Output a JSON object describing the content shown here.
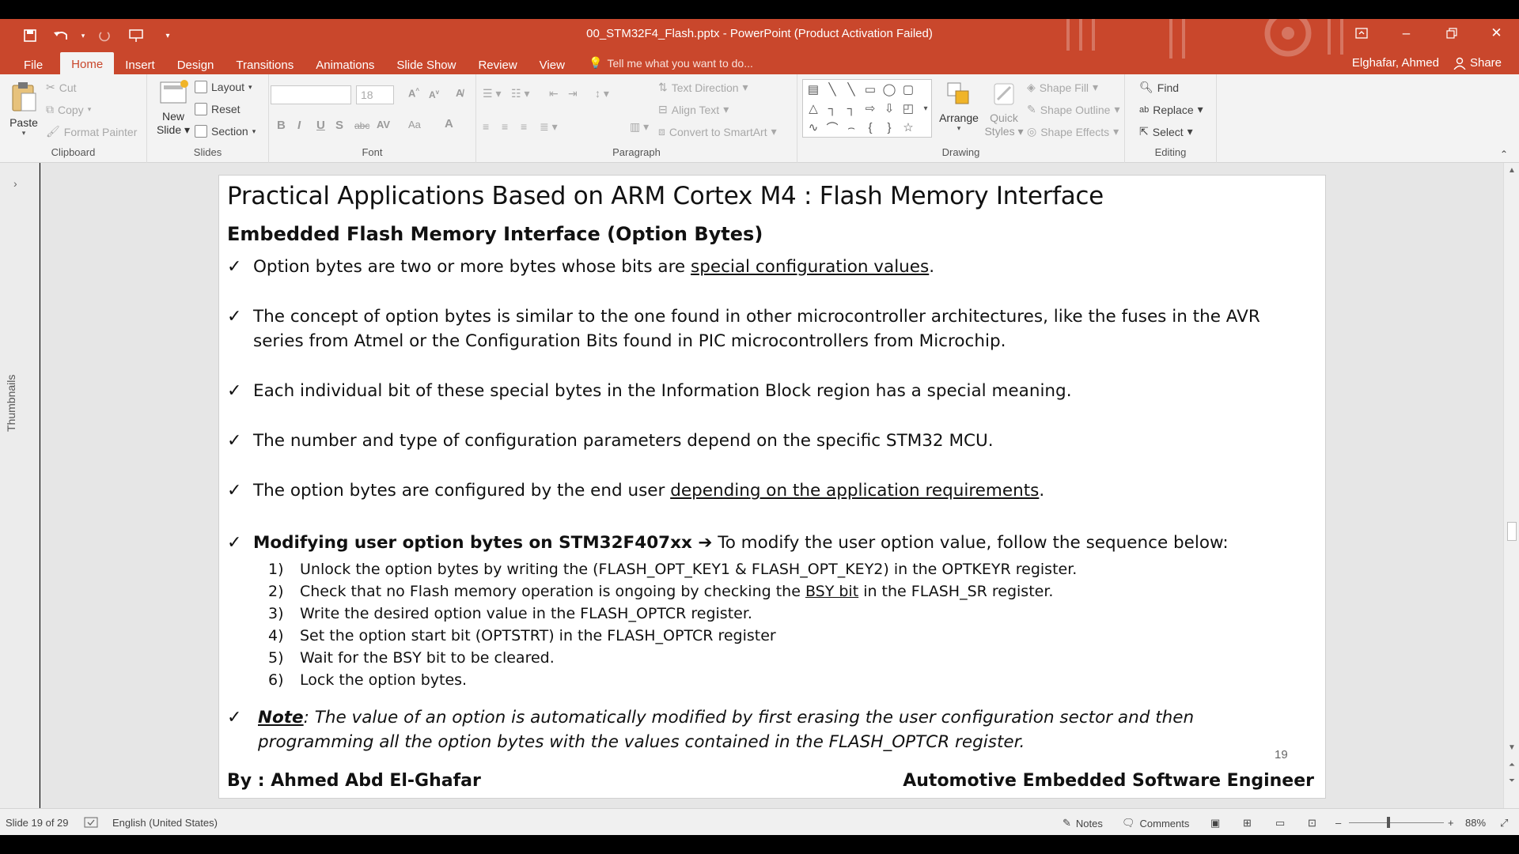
{
  "window": {
    "title": "00_STM32F4_Flash.pptx - PowerPoint (Product Activation Failed)",
    "qat": [
      "save-icon",
      "undo-icon",
      "redo-icon",
      "present-icon",
      "customize-icon"
    ],
    "controls": [
      "ribbon-display-icon",
      "minimize-icon",
      "restore-icon",
      "close-icon"
    ]
  },
  "tabs": [
    "File",
    "Home",
    "Insert",
    "Design",
    "Transitions",
    "Animations",
    "Slide Show",
    "Review",
    "View"
  ],
  "active_tab": "Home",
  "tell_me": "Tell me what you want to do...",
  "user": {
    "name": "Elghafar, Ahmed",
    "share": "Share"
  },
  "ribbon": {
    "clipboard": {
      "label": "Clipboard",
      "paste": "Paste",
      "cut": "Cut",
      "copy": "Copy",
      "format_painter": "Format Painter"
    },
    "slides": {
      "label": "Slides",
      "new_slide": "New",
      "new_slide2": "Slide",
      "layout": "Layout",
      "reset": "Reset",
      "section": "Section"
    },
    "font": {
      "label": "Font",
      "size": "18",
      "bold": "B",
      "italic": "I",
      "underline": "U",
      "shadow": "S",
      "strike": "abc",
      "spacing": "AV",
      "case": "Aa",
      "color": "A"
    },
    "paragraph": {
      "label": "Paragraph",
      "text_direction": "Text Direction",
      "align_text": "Align Text",
      "convert_smartart": "Convert to SmartArt"
    },
    "drawing": {
      "label": "Drawing",
      "arrange": "Arrange",
      "quick_styles": "Quick",
      "quick_styles2": "Styles",
      "shape_fill": "Shape Fill",
      "shape_outline": "Shape Outline",
      "shape_effects": "Shape Effects"
    },
    "editing": {
      "label": "Editing",
      "find": "Find",
      "replace": "Replace",
      "select": "Select"
    }
  },
  "thumbnails_label": "Thumbnails",
  "slide": {
    "title": "Practical Applications Based on ARM Cortex M4 : Flash Memory Interface",
    "subtitle": "Embedded Flash Memory Interface (Option Bytes)",
    "b1_pre": "Option bytes are two or more bytes whose bits are ",
    "b1_u": "special configuration values",
    "b1_post": ".",
    "b2": "The concept of option bytes is similar to the one found in other microcontroller architectures, like the fuses in the AVR series from Atmel or the Configuration Bits found in PIC microcontrollers from Microchip.",
    "b3": "Each individual bit of these special bytes in the Information Block region has a special meaning.",
    "b4": "The number and type of configuration parameters depend on the specific STM32 MCU.",
    "b5_pre": "The option bytes are configured by the end user ",
    "b5_u": "depending on the application requirements",
    "b5_post": ".",
    "b6_bold": "Modifying user option bytes on STM32F407xx ",
    "b6_arrow": "➔",
    "b6_rest": " To modify the user option value, follow the sequence below:",
    "steps": [
      {
        "num": "1)",
        "pre": "Unlock the option bytes by writing the (FLASH_OPT_KEY1 & FLASH_OPT_KEY2) in the OPTKEYR register.",
        "u": "",
        "post": ""
      },
      {
        "num": "2)",
        "pre": "Check that no Flash memory operation is ongoing by checking the ",
        "u": "BSY bit",
        "post": " in the FLASH_SR register."
      },
      {
        "num": "3)",
        "pre": "Write the desired option value in the FLASH_OPTCR register.",
        "u": "",
        "post": ""
      },
      {
        "num": "4)",
        "pre": "Set the option start bit (OPTSTRT) in the FLASH_OPTCR register",
        "u": "",
        "post": ""
      },
      {
        "num": "5)",
        "pre": "Wait for the BSY bit to be cleared.",
        "u": "",
        "post": ""
      },
      {
        "num": "6)",
        "pre": "Lock the option bytes.",
        "u": "",
        "post": ""
      }
    ],
    "note_label": "Note",
    "note_text": ": The value of an option is automatically modified by first erasing the user configuration sector and then programming all the option bytes with the values contained in the FLASH_OPTCR register.",
    "page_number": "19",
    "footer_left": "By : Ahmed Abd El-Ghafar",
    "footer_right": "Automotive Embedded Software Engineer"
  },
  "status": {
    "slide_info": "Slide 19 of 29",
    "language": "English (United States)",
    "notes": "Notes",
    "comments": "Comments",
    "zoom_level": "88%",
    "zoom_fraction": 0.42
  },
  "colors": {
    "accent": "#c9472c",
    "ribbon_bg": "#f3f3f3",
    "workspace_bg": "#e6e6e6"
  }
}
